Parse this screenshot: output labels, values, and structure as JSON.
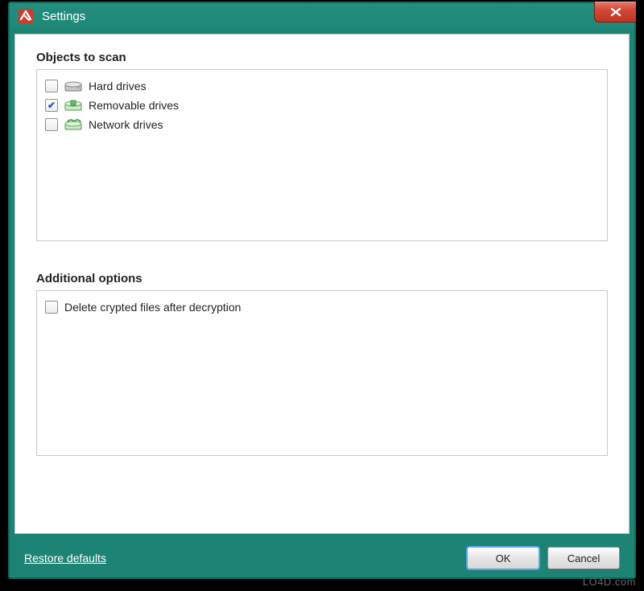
{
  "window": {
    "title": "Settings"
  },
  "sections": {
    "objects_title": "Objects to scan",
    "additional_title": "Additional options"
  },
  "scan_items": [
    {
      "label": "Hard drives",
      "checked": false,
      "icon": "hdd"
    },
    {
      "label": "Removable drives",
      "checked": true,
      "icon": "removable"
    },
    {
      "label": "Network drives",
      "checked": false,
      "icon": "network"
    }
  ],
  "additional_items": [
    {
      "label": "Delete crypted files after decryption",
      "checked": false
    }
  ],
  "footer": {
    "restore_defaults": "Restore defaults",
    "ok": "OK",
    "cancel": "Cancel"
  },
  "watermark": "LO4D.com",
  "colors": {
    "window_bg": "#1d8475",
    "close_bg": "#d34a38"
  }
}
